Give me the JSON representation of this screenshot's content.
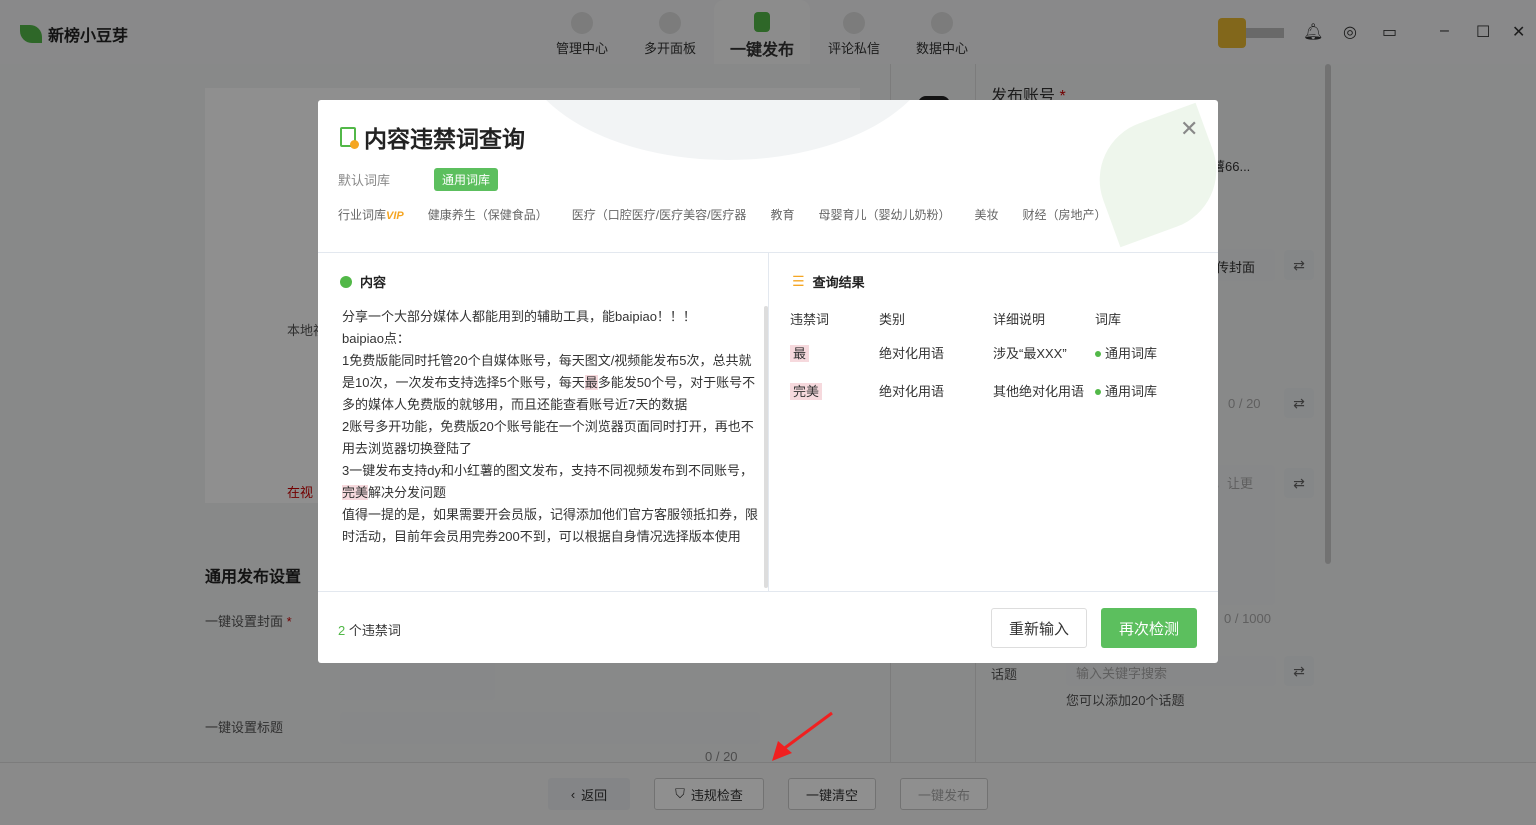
{
  "app": {
    "name": "新榜小豆芽"
  },
  "nav": [
    {
      "label": "管理中心"
    },
    {
      "label": "多开面板"
    },
    {
      "label": "一键发布",
      "active": true
    },
    {
      "label": "评论私信"
    },
    {
      "label": "数据中心"
    }
  ],
  "background": {
    "local_label": "本地视",
    "red_hint": "在视",
    "general_settings": "通用发布设置",
    "cover_label": "一键设置封面",
    "title_label": "一键设置标题",
    "title_count": "0 / 20",
    "account_label": "发布账号",
    "account_name": "薯66...",
    "upload_cover": "传封面",
    "r_count1": "0 / 20",
    "r_placeholder": "，让更",
    "r_count2": "0 / 1000",
    "topic_label": "话题",
    "topic_placeholder": "输入关键字搜索",
    "topic_hint": "您可以添加20个话题",
    "required": "*"
  },
  "bottom": {
    "back": "返回",
    "check": "违规检查",
    "clear": "一键清空",
    "publish": "一键发布"
  },
  "modal": {
    "title": "内容违禁词查询",
    "default_lib_label": "默认词库",
    "default_lib_tag": "通用词库",
    "industry_label": "行业词库",
    "vip": "VIP",
    "industries": [
      "健康养生（保健食品）",
      "医疗（口腔医疗/医疗美容/医疗器",
      "教育",
      "母婴育儿（婴幼儿奶粉）",
      "美妆",
      "财经（房地产）"
    ],
    "content_title": "内容",
    "result_title": "查询结果",
    "content_pre": "分享一个大部分媒体人都能用到的辅助工具，能baipiao！！！\nbaipiao点：\n1免费版能同时托管20个自媒体账号，每天图文/视频能发布5次，总共就是10次，一次发布支持选择5个账号，每天",
    "content_hl1": "最",
    "content_mid": "多能发50个号，对于账号不多的媒体人免费版的就够用，而且还能查看账号近7天的数据\n2账号多开功能，免费版20个账号能在一个浏览器页面同时打开，再也不用去浏览器切换登陆了\n3一键发布支持dy和小红薯的图文发布，支持不同视频发布到不同账号，",
    "content_hl2": "完美",
    "content_post": "解决分发问题\n值得一提的是，如果需要开会员版，记得添加他们官方客服领抵扣券，限时活动，目前年会员用完券200不到，可以根据自身情况选择版本使用",
    "columns": [
      "违禁词",
      "类别",
      "详细说明",
      "词库"
    ],
    "rows": [
      {
        "word": "最",
        "category": "绝对化用语",
        "detail": "涉及“最XXX”",
        "lib": "通用词库"
      },
      {
        "word": "完美",
        "category": "绝对化用语",
        "detail": "其他绝对化用语",
        "lib": "通用词库"
      }
    ],
    "count_num": "2",
    "count_text": " 个违禁词",
    "reset": "重新输入",
    "recheck": "再次检测"
  },
  "colors": {
    "accent": "#5cbf5e",
    "highlight": "#f6d9dd",
    "vip": "#f5a623"
  }
}
